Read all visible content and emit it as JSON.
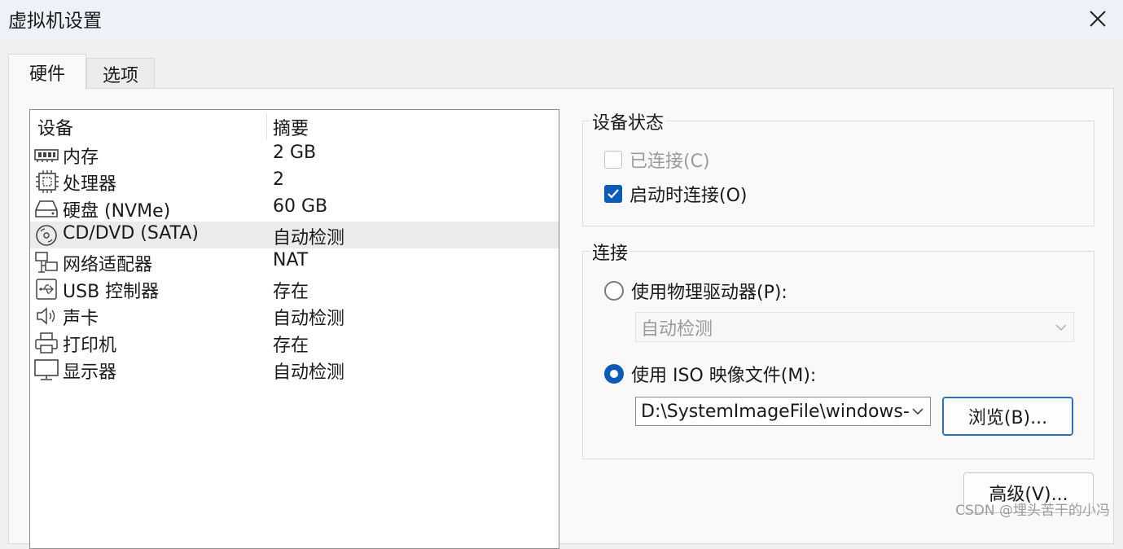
{
  "window": {
    "title": "虚拟机设置"
  },
  "tabs": [
    {
      "label": "硬件",
      "selected": true
    },
    {
      "label": "选项",
      "selected": false
    }
  ],
  "device_list": {
    "columns": [
      "设备",
      "摘要"
    ],
    "rows": [
      {
        "icon": "memory-icon",
        "name": "内存",
        "summary": "2 GB"
      },
      {
        "icon": "processor-icon",
        "name": "处理器",
        "summary": "2"
      },
      {
        "icon": "harddisk-icon",
        "name": "硬盘 (NVMe)",
        "summary": "60 GB"
      },
      {
        "icon": "cd-dvd-icon",
        "name": "CD/DVD (SATA)",
        "summary": "自动检测",
        "selected": true
      },
      {
        "icon": "network-adapter-icon",
        "name": "网络适配器",
        "summary": "NAT"
      },
      {
        "icon": "usb-icon",
        "name": "USB 控制器",
        "summary": "存在"
      },
      {
        "icon": "sound-card-icon",
        "name": "声卡",
        "summary": "自动检测"
      },
      {
        "icon": "printer-icon",
        "name": "打印机",
        "summary": "存在"
      },
      {
        "icon": "display-icon",
        "name": "显示器",
        "summary": "自动检测"
      }
    ]
  },
  "device_status": {
    "title": "设备状态",
    "connected": {
      "label": "已连接(C)",
      "checked": false,
      "disabled": true
    },
    "connect_at_power_on": {
      "label": "启动时连接(O)",
      "checked": true
    }
  },
  "connection": {
    "title": "连接",
    "physical_drive": {
      "label": "使用物理驱动器(P):",
      "selected": false,
      "dropdown_value": "自动检测"
    },
    "iso_image": {
      "label": "使用 ISO 映像文件(M):",
      "selected": true,
      "path_value": "D:\\SystemImageFile\\windows-"
    },
    "browse_button": "浏览(B)..."
  },
  "advanced_button": "高级(V)...",
  "watermark": "CSDN @埋头苦干的小冯",
  "colors": {
    "accent": "#0a5cb8",
    "selected_row": "#ebebeb",
    "titlebar": "#edf2f9"
  }
}
